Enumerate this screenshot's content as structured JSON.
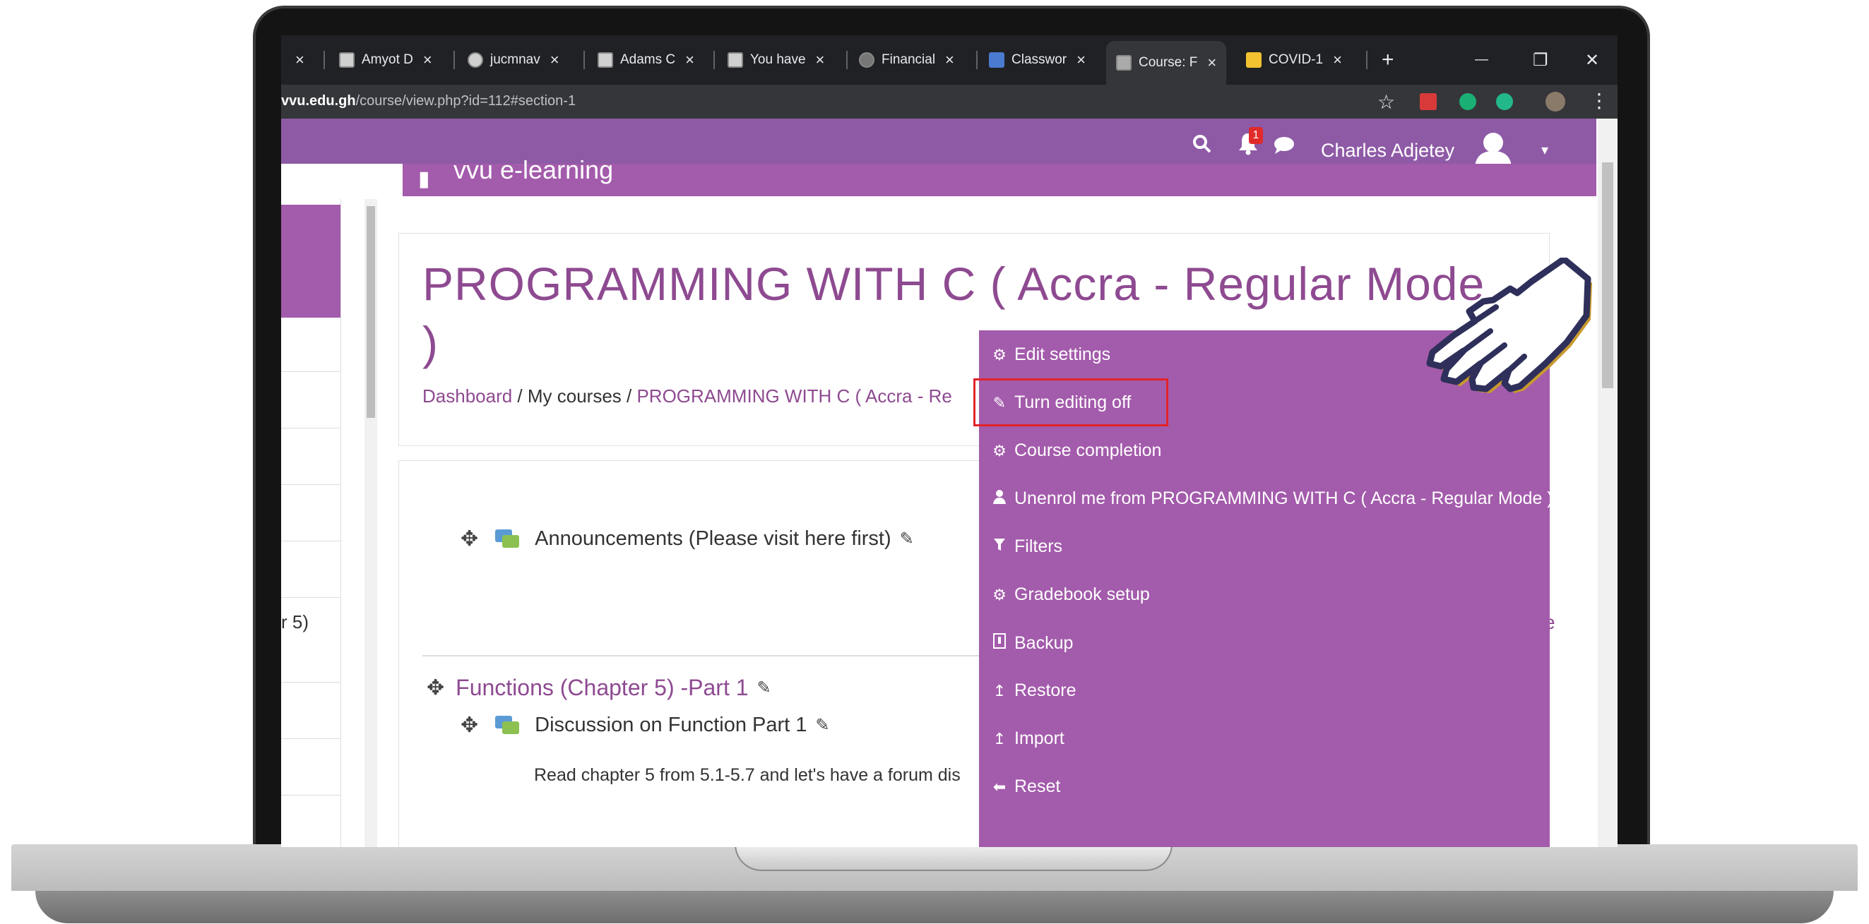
{
  "browser": {
    "tabs": [
      {
        "label": "",
        "close": "×"
      },
      {
        "label": "Amyot D",
        "close": "×"
      },
      {
        "label": "jucmnav",
        "close": "×"
      },
      {
        "label": "Adams C",
        "close": "×"
      },
      {
        "label": "You have",
        "close": "×"
      },
      {
        "label": "Financial",
        "close": "×"
      },
      {
        "label": "Classwor",
        "close": "×"
      },
      {
        "label": "Course: F",
        "close": "×"
      },
      {
        "label": "COVID-1",
        "close": "×"
      }
    ],
    "new_tab": "+",
    "window_minimize": "—",
    "window_restore": "❐",
    "window_close": "✕",
    "url_domain": "vvu.edu.gh",
    "url_path": "/course/view.php?id=112#section-1"
  },
  "header": {
    "notification_count": "1",
    "user_name": "Charles Adjetey",
    "brand": "vvu e-learning"
  },
  "course": {
    "title_line1": "PROGRAMMING WITH C ( Accra - Regular Mode",
    "title_line2": ")",
    "breadcrumb": {
      "dashboard": "Dashboard",
      "sep1": " / ",
      "my_courses": "My courses",
      "sep2": " /  ",
      "current": "PROGRAMMING WITH C ( Accra - Re"
    }
  },
  "content": {
    "announcements": "Announcements (Please visit here first)",
    "section_title": "Functions (Chapter 5) -Part 1",
    "discussion": "Discussion on Function Part 1",
    "description": "Read chapter 5 from 5.1-5.7 and let's have a forum dis",
    "sidebar_fragment": "r 5)",
    "right_fragment": "e"
  },
  "menu": {
    "items": [
      {
        "icon": "gear",
        "label": "Edit settings"
      },
      {
        "icon": "pencil",
        "label": "Turn editing off"
      },
      {
        "icon": "gear",
        "label": "Course completion"
      },
      {
        "icon": "user",
        "label": "Unenrol me from PROGRAMMING WITH C ( Accra - Regular Mode )"
      },
      {
        "icon": "filter",
        "label": "Filters"
      },
      {
        "icon": "gear",
        "label": "Gradebook setup"
      },
      {
        "icon": "backup",
        "label": "Backup"
      },
      {
        "icon": "upload",
        "label": "Restore"
      },
      {
        "icon": "upload",
        "label": "Import"
      },
      {
        "icon": "arrow-left",
        "label": "Reset"
      }
    ]
  },
  "colors": {
    "moodle_header": "#8e5aa6",
    "menu_bg": "#a35bab",
    "title_purple": "#8e4a91",
    "highlight_red": "#e2222a"
  }
}
